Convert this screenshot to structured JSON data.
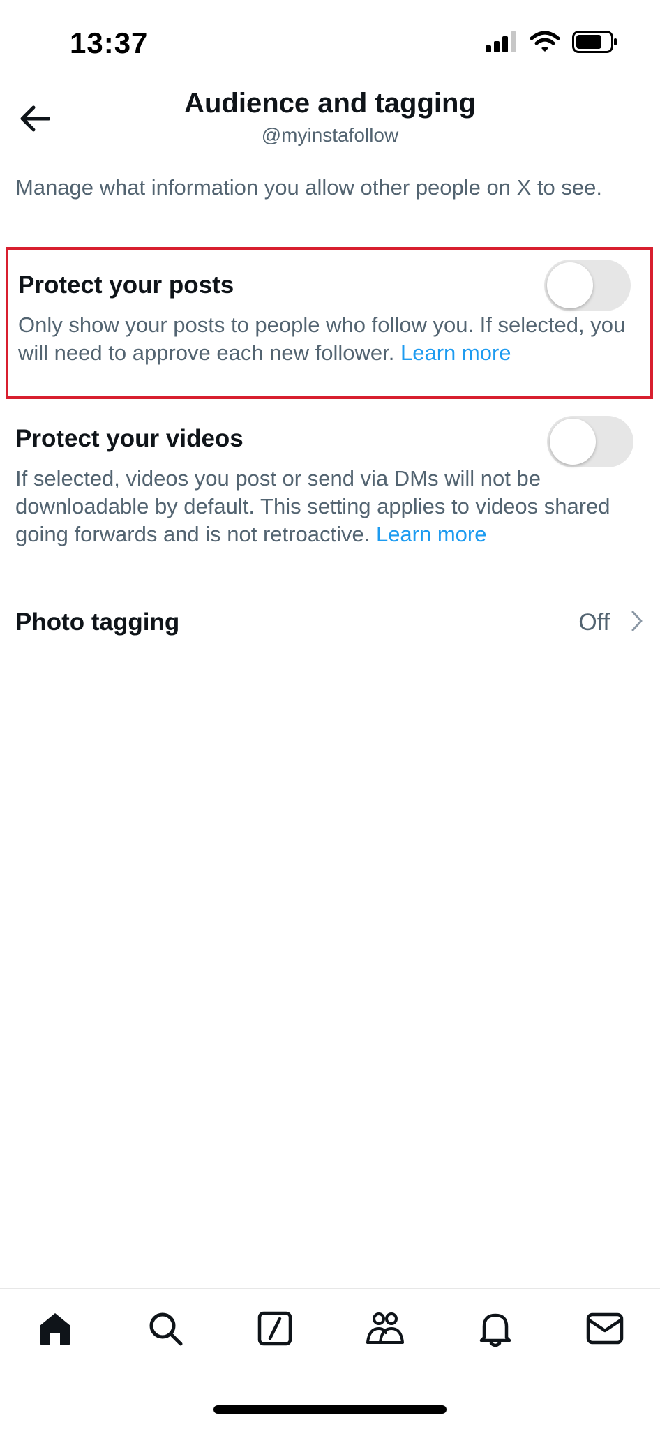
{
  "status_bar": {
    "time": "13:37",
    "icons": [
      "cellular-signal-icon",
      "wifi-icon",
      "battery-icon"
    ]
  },
  "header": {
    "title": "Audience and tagging",
    "handle": "@myinstafollow",
    "back_icon": "arrow-left-icon"
  },
  "intro": "Manage what information you allow other people on X to see.",
  "settings": {
    "protect_posts": {
      "title": "Protect your posts",
      "description": "Only show your posts to people who follow you. If selected, you will need to approve each new follower.",
      "link": "Learn more",
      "enabled": false
    },
    "protect_videos": {
      "title": "Protect your videos",
      "description": "If selected, videos you post or send via DMs will not be downloadable by default. This setting applies to videos shared going forwards and is not retroactive.",
      "link": "Learn more",
      "enabled": false
    },
    "photo_tagging": {
      "title": "Photo tagging",
      "value": "Off"
    }
  },
  "bottom_nav": {
    "items": [
      "home-icon",
      "search-icon",
      "grok-icon",
      "communities-icon",
      "notifications-icon",
      "messages-icon"
    ],
    "active": "home-icon"
  },
  "colors": {
    "text_primary": "#0f1419",
    "text_secondary": "#536471",
    "link": "#1d9bf0",
    "highlight_border": "#d81f2f",
    "toggle_off": "#e6e6e6"
  }
}
